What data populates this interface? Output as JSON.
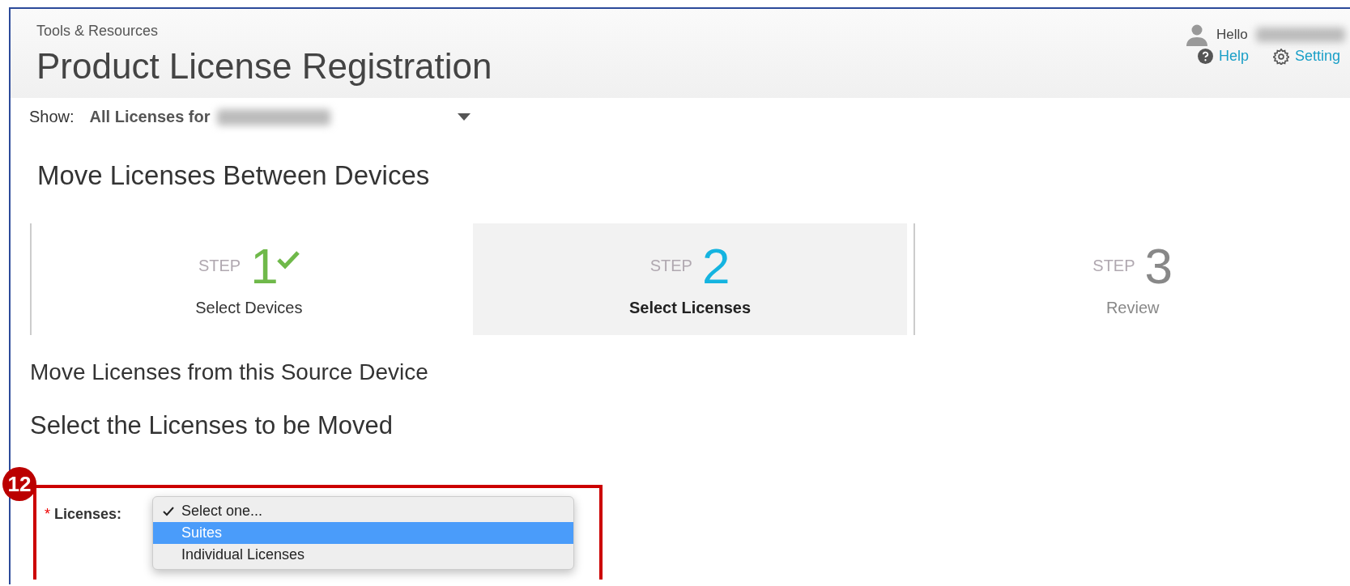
{
  "header": {
    "breadcrumb": "Tools & Resources",
    "title": "Product License Registration",
    "greeting": "Hello",
    "links": [
      {
        "label": "Help",
        "kind": "help"
      },
      {
        "label": "Setting",
        "kind": "settings"
      }
    ]
  },
  "show": {
    "label": "Show:",
    "value": "All Licenses for"
  },
  "section_title": "Move Licenses Between Devices",
  "steps": [
    {
      "prefix": "STEP",
      "number": "1",
      "label": "Select Devices",
      "completed": true,
      "selected": false
    },
    {
      "prefix": "STEP",
      "number": "2",
      "label": "Select Licenses",
      "completed": false,
      "selected": true
    },
    {
      "prefix": "STEP",
      "number": "3",
      "label": "Review",
      "completed": false,
      "selected": false
    }
  ],
  "source_heading": "Move Licenses from this Source Device",
  "select_heading": "Select the Licenses to be Moved",
  "annotation": {
    "badge": "12"
  },
  "licenses_field": {
    "required_mark": "*",
    "label": "Licenses:",
    "options": [
      {
        "label": "Select one...",
        "checked": true,
        "selected": false
      },
      {
        "label": "Suites",
        "checked": false,
        "selected": true
      },
      {
        "label": "Individual Licenses",
        "checked": false,
        "selected": false
      }
    ]
  }
}
